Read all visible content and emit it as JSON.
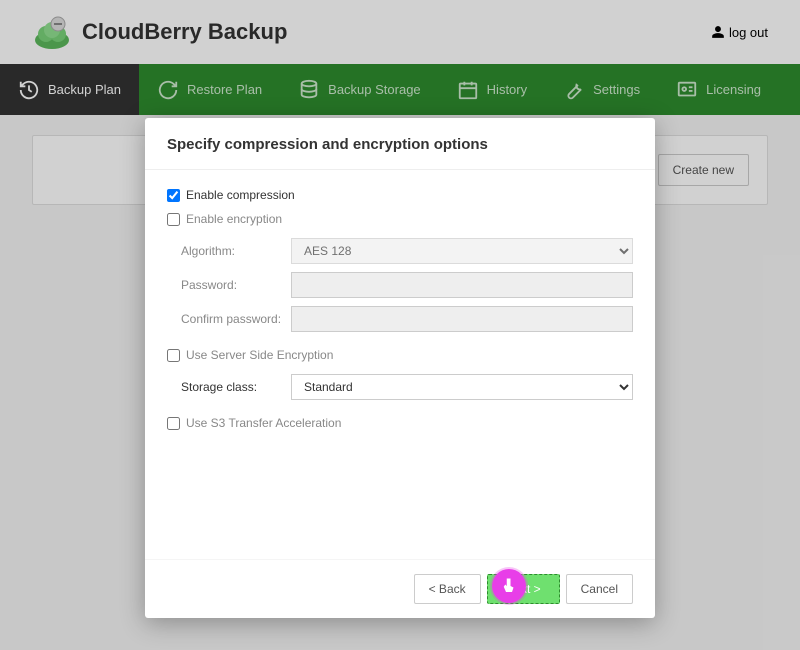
{
  "app": {
    "title": "CloudBerry Backup",
    "logout": "log out"
  },
  "nav": {
    "items": [
      {
        "label": "Backup Plan"
      },
      {
        "label": "Restore Plan"
      },
      {
        "label": "Backup Storage"
      },
      {
        "label": "History"
      },
      {
        "label": "Settings"
      },
      {
        "label": "Licensing"
      }
    ]
  },
  "content": {
    "create_new": "Create new"
  },
  "modal": {
    "title": "Specify compression and encryption options",
    "enable_compression": "Enable compression",
    "enable_encryption": "Enable encryption",
    "algorithm_label": "Algorithm:",
    "algorithm_value": "AES 128",
    "password_label": "Password:",
    "confirm_password_label": "Confirm password:",
    "use_sse": "Use Server Side Encryption",
    "storage_class_label": "Storage class:",
    "storage_class_value": "Standard",
    "use_s3_accel": "Use S3 Transfer Acceleration",
    "back": "< Back",
    "next": "Next >",
    "cancel": "Cancel"
  }
}
